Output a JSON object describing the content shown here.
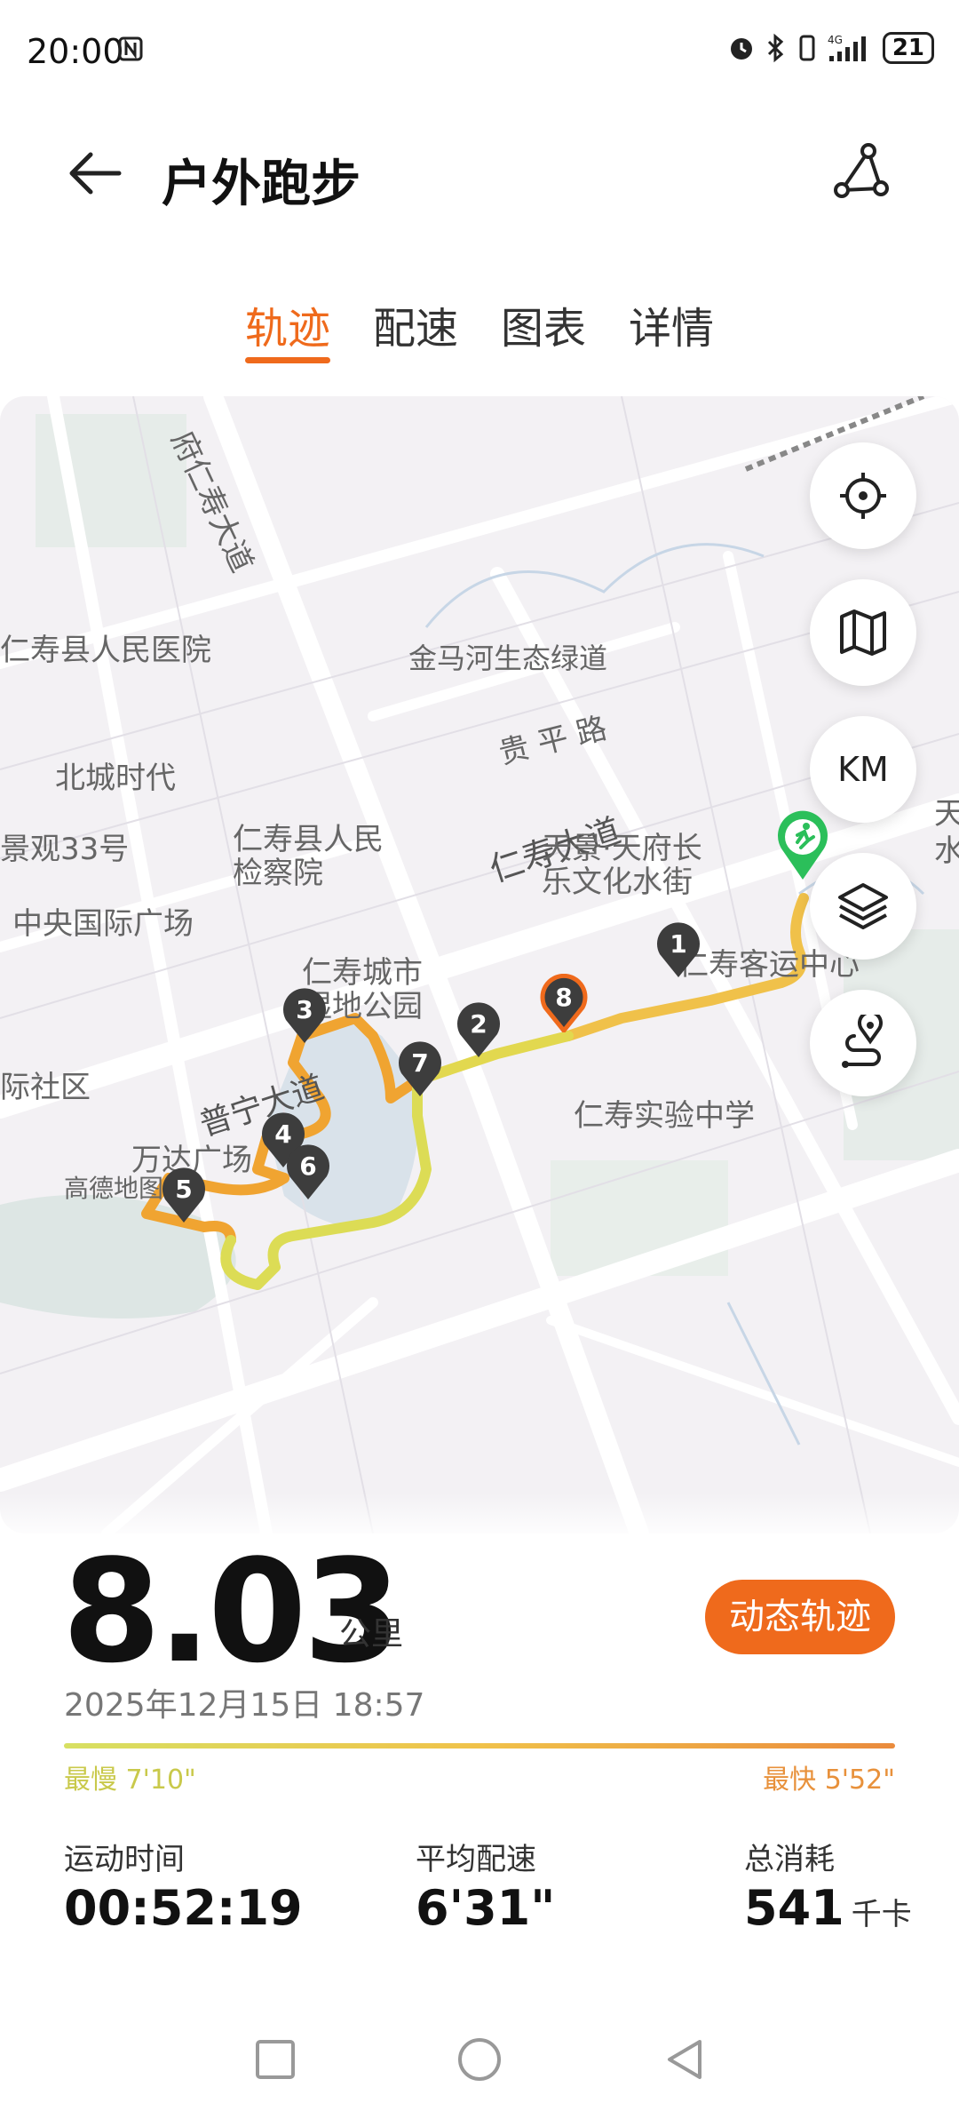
{
  "status_bar": {
    "time": "20:00",
    "icons": [
      "nfc-icon",
      "alarm-icon",
      "bluetooth-icon",
      "vibrate-icon",
      "signal-icon"
    ],
    "network": "4G",
    "battery": "21"
  },
  "header": {
    "title": "户外跑步",
    "back_icon": "arrow-left-icon",
    "share_icon": "route-share-icon"
  },
  "tabs": [
    {
      "label": "轨迹",
      "active": true
    },
    {
      "label": "配速",
      "active": false
    },
    {
      "label": "图表",
      "active": false
    },
    {
      "label": "详情",
      "active": false
    }
  ],
  "map": {
    "labels": [
      "府仁寿大道",
      "仁寿县人民医院",
      "金马河生态绿道",
      "贵 平 路",
      "北城时代",
      "仁寿大道",
      "景观33号",
      "仁寿县人民检察院",
      "天景·天府长乐文化水街",
      "中央国际广场",
      "仁寿城市湿地公园",
      "仁寿客运中心",
      "际社区",
      "普宁大道",
      "仁寿实验中学",
      "万达广场",
      "高德地图",
      "天",
      "水"
    ],
    "buttons": {
      "locate": "crosshair-icon",
      "map_type": "map-icon",
      "km": "KM",
      "layers": "layers-icon",
      "route": "route-icon"
    },
    "markers": [
      "1",
      "2",
      "3",
      "4",
      "5",
      "6",
      "7",
      "8"
    ],
    "start_icon": "runner-icon",
    "colors": {
      "route_slow": "#dede5a",
      "route_fast": "#f0a431",
      "accent": "#ef6a1c",
      "start": "#2bbf5a"
    }
  },
  "summary": {
    "distance": "8.03",
    "distance_unit": "公里",
    "dynamic_button": "动态轨迹",
    "date": "2025年12月15日 18:57",
    "slowest": "最慢 7'10\"",
    "fastest": "最快 5'52\"",
    "metrics": [
      {
        "label": "运动时间",
        "value": "00:52:19",
        "unit": ""
      },
      {
        "label": "平均配速",
        "value": "6'31\"",
        "unit": ""
      },
      {
        "label": "总消耗",
        "value": "541",
        "unit": "千卡"
      }
    ]
  },
  "navbar": {
    "recent": "square-icon",
    "home": "circle-icon",
    "back": "triangle-back-icon"
  }
}
